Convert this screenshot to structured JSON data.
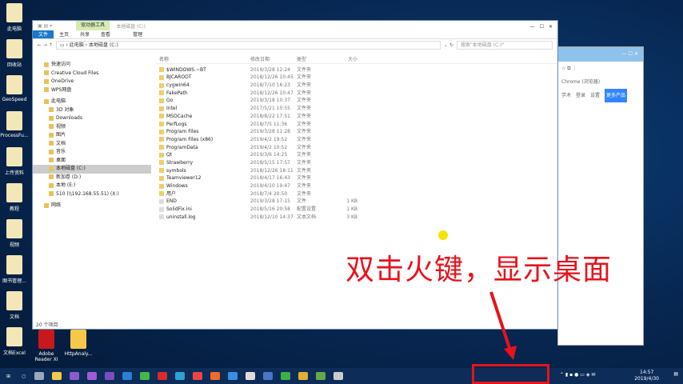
{
  "desktop": {
    "icons": [
      "此电脑",
      "回收站",
      "GeoSpeed",
      "ProcessFu...",
      "上传资料",
      "教程",
      "视频",
      "图书管理...",
      "文档",
      "文档Excel"
    ],
    "bottom_icons": [
      "Adobe Reader XI",
      "HttpAnaly..."
    ]
  },
  "explorer": {
    "title": "本地磁盘 (C:)",
    "context_tab": "驱动器工具",
    "tabs": [
      "文件",
      "主页",
      "共享",
      "查看",
      "管理"
    ],
    "breadcrumb": [
      "此电脑",
      "本地磁盘 (C:)"
    ],
    "search_placeholder": "搜索\"本地磁盘 (C:)\"",
    "nav": [
      {
        "label": "快速访问",
        "level": 0
      },
      {
        "label": "Creative Cloud Files",
        "level": 0
      },
      {
        "label": "OneDrive",
        "level": 0
      },
      {
        "label": "WPS网盘",
        "level": 0
      },
      {
        "label": "此电脑",
        "level": 0
      },
      {
        "label": "3D 对象",
        "level": 1
      },
      {
        "label": "Downloads",
        "level": 1
      },
      {
        "label": "视频",
        "level": 1
      },
      {
        "label": "图片",
        "level": 1
      },
      {
        "label": "文档",
        "level": 1
      },
      {
        "label": "音乐",
        "level": 1
      },
      {
        "label": "桌面",
        "level": 1
      },
      {
        "label": "本地磁盘 (C:)",
        "level": 1,
        "selected": true
      },
      {
        "label": "新加卷 (D:)",
        "level": 1
      },
      {
        "label": "本地 (E:)",
        "level": 1
      },
      {
        "label": "510 (\\\\192.168.55.51) (X:)",
        "level": 1
      },
      {
        "label": "网络",
        "level": 0
      }
    ],
    "columns": [
      "名称",
      "修改日期",
      "类型",
      "大小"
    ],
    "files": [
      [
        "$WINDOWS.~BT",
        "2019/3/28 12:24",
        "文件夹",
        ""
      ],
      [
        "BJCAROOT",
        "2018/12/26 10:45",
        "文件夹",
        ""
      ],
      [
        "cygwin64",
        "2018/7/10 16:23",
        "文件夹",
        ""
      ],
      [
        "FakePath",
        "2018/12/26 10:47",
        "文件夹",
        ""
      ],
      [
        "Go",
        "2019/3/18 10:37",
        "文件夹",
        ""
      ],
      [
        "Intel",
        "2017/5/21 10:55",
        "文件夹",
        ""
      ],
      [
        "MSOCache",
        "2018/8/22 17:51",
        "文件夹",
        ""
      ],
      [
        "PerfLogs",
        "2018/7/5 11:36",
        "文件夹",
        ""
      ],
      [
        "Program Files",
        "2019/3/28 11:28",
        "文件夹",
        ""
      ],
      [
        "Program Files (x86)",
        "2019/4/2 19:52",
        "文件夹",
        ""
      ],
      [
        "ProgramData",
        "2019/4/2 10:52",
        "文件夹",
        ""
      ],
      [
        "Qt",
        "2019/3/6 14:25",
        "文件夹",
        ""
      ],
      [
        "Strawberry",
        "2018/5/15 17:57",
        "文件夹",
        ""
      ],
      [
        "symbols",
        "2018/12/26 18:11",
        "文件夹",
        ""
      ],
      [
        "Teamviewer12",
        "2018/4/17 16:43",
        "文件夹",
        ""
      ],
      [
        "Windows",
        "2019/4/10 19:47",
        "文件夹",
        ""
      ],
      [
        "用户",
        "2018/7/4 20:50",
        "文件夹",
        ""
      ],
      [
        "END",
        "2019/3/28 17:15",
        "文件",
        "1 KB"
      ],
      [
        "SolidFix.ini",
        "2018/5/16 20:58",
        "配置设置",
        "1 KB"
      ],
      [
        "uninstall.log",
        "2018/12/10 14:37",
        "文本文档",
        "3 KB"
      ]
    ],
    "status": "20 个项目"
  },
  "chrome": {
    "bookmark": "Chrome (浏览器)",
    "links": [
      "学术",
      "登录",
      "设置"
    ],
    "button": "更多产品"
  },
  "annotation": "双击火键，显示桌面",
  "clock": {
    "time": "14:57",
    "date": "2019/4/30"
  },
  "colors": {
    "annotation": "#e8121c",
    "accent": "#1979ca"
  }
}
